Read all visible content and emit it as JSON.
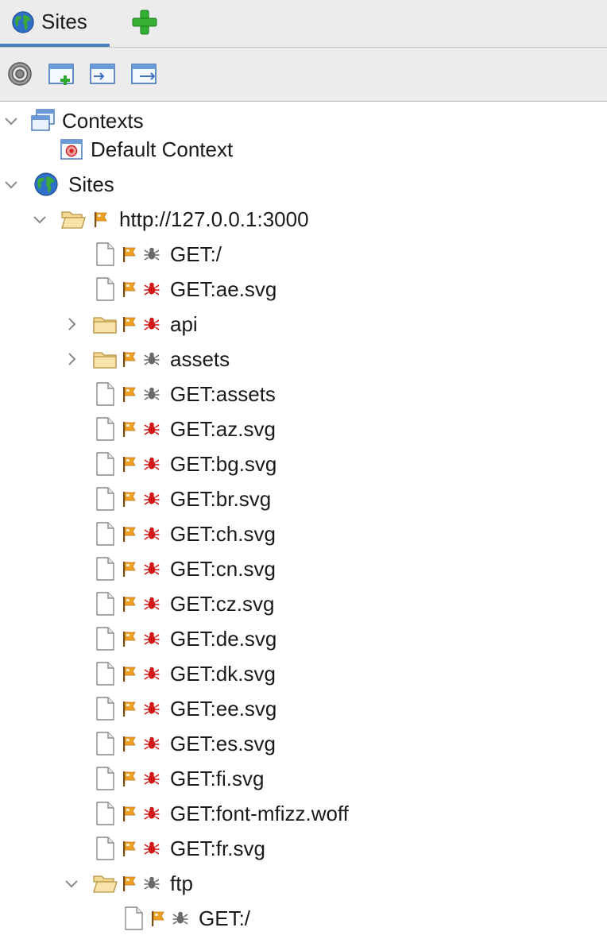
{
  "tabs": {
    "active_label": "Sites",
    "active_icon": "globe-icon",
    "add_icon": "plus-icon"
  },
  "toolbar": {
    "icons": [
      "target-icon",
      "new-context-icon",
      "import-context-icon",
      "export-context-icon"
    ]
  },
  "tree": {
    "contexts_label": "Contexts",
    "default_context_label": "Default Context",
    "sites_label": "Sites",
    "host_label": "http://127.0.0.1:3000",
    "host_children": [
      {
        "label": "GET:/",
        "type": "file",
        "alert": "gray"
      },
      {
        "label": "GET:ae.svg",
        "type": "file",
        "alert": "red"
      },
      {
        "label": "api",
        "type": "folder",
        "alert": "red"
      },
      {
        "label": "assets",
        "type": "folder",
        "alert": "gray"
      },
      {
        "label": "GET:assets",
        "type": "file",
        "alert": "gray"
      },
      {
        "label": "GET:az.svg",
        "type": "file",
        "alert": "red"
      },
      {
        "label": "GET:bg.svg",
        "type": "file",
        "alert": "red"
      },
      {
        "label": "GET:br.svg",
        "type": "file",
        "alert": "red"
      },
      {
        "label": "GET:ch.svg",
        "type": "file",
        "alert": "red"
      },
      {
        "label": "GET:cn.svg",
        "type": "file",
        "alert": "red"
      },
      {
        "label": "GET:cz.svg",
        "type": "file",
        "alert": "red"
      },
      {
        "label": "GET:de.svg",
        "type": "file",
        "alert": "red"
      },
      {
        "label": "GET:dk.svg",
        "type": "file",
        "alert": "red"
      },
      {
        "label": "GET:ee.svg",
        "type": "file",
        "alert": "red"
      },
      {
        "label": "GET:es.svg",
        "type": "file",
        "alert": "red"
      },
      {
        "label": "GET:fi.svg",
        "type": "file",
        "alert": "red"
      },
      {
        "label": "GET:font-mfizz.woff",
        "type": "file",
        "alert": "red"
      },
      {
        "label": "GET:fr.svg",
        "type": "file",
        "alert": "red"
      },
      {
        "label": "ftp",
        "type": "folder-open",
        "alert": "gray"
      }
    ],
    "ftp_children": [
      {
        "label": "GET:/",
        "type": "file",
        "alert": "gray"
      }
    ]
  },
  "colors": {
    "tab_accent": "#4a7fc0",
    "flag_orange": "#f0a020",
    "alert_red": "#d01818",
    "alert_gray": "#6a6a6a"
  }
}
